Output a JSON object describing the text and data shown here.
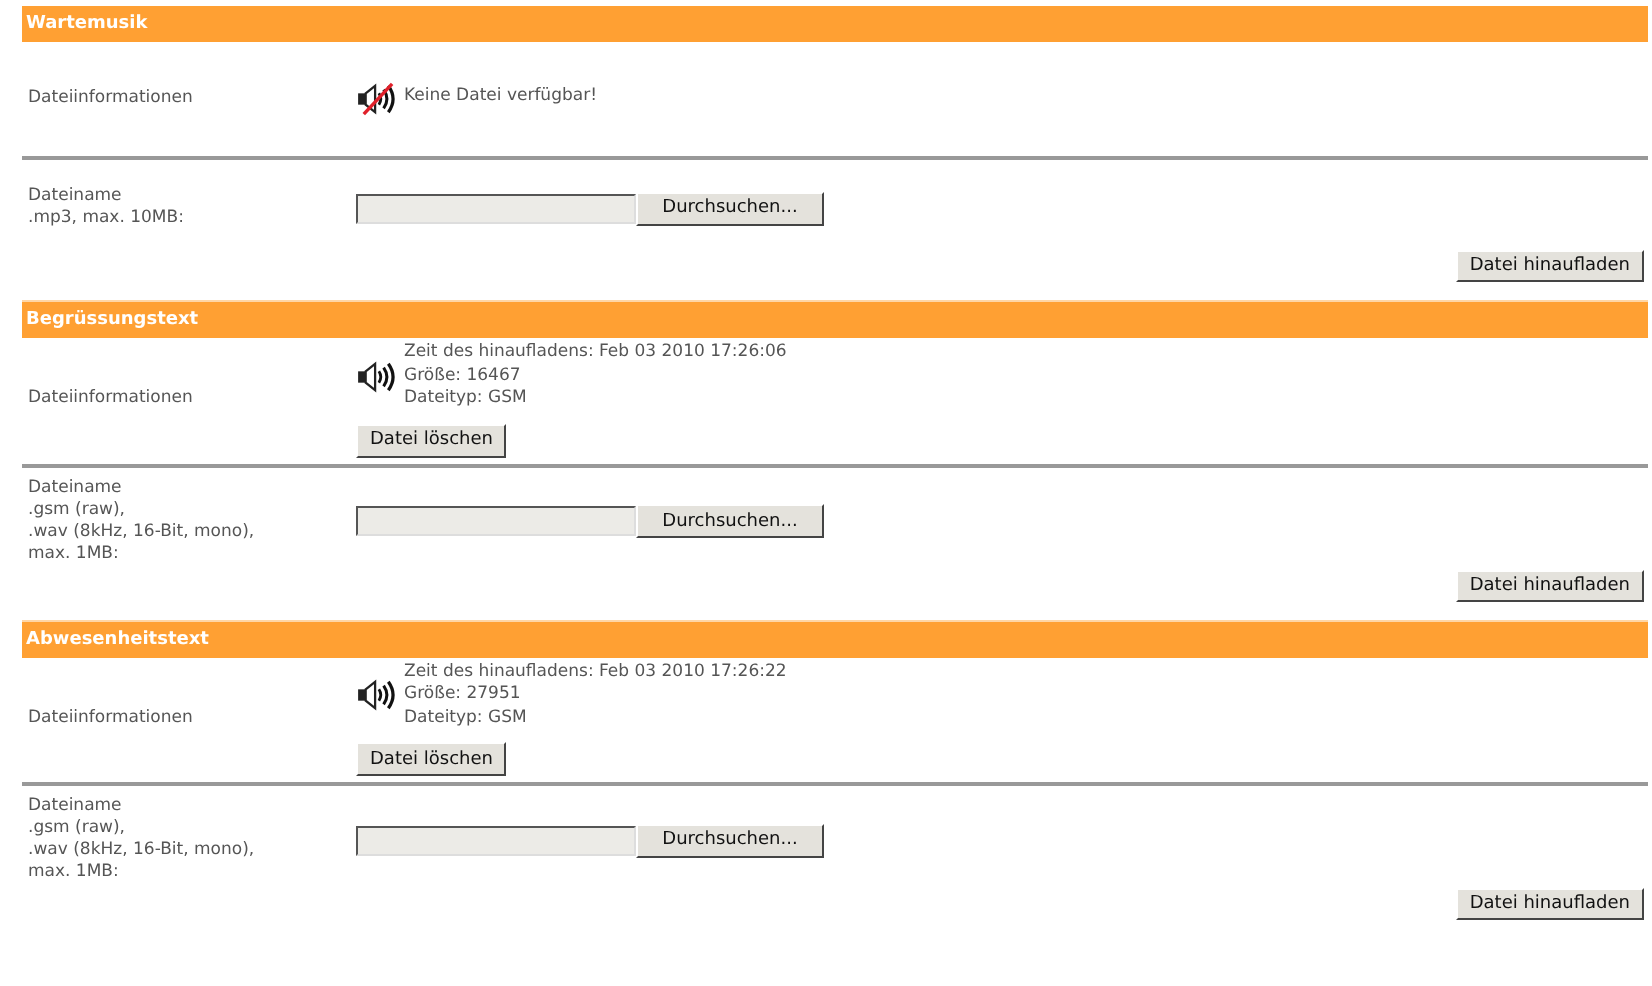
{
  "sections": [
    {
      "title": "Wartemusik",
      "info_label": "Dateiinformationen",
      "file": {
        "kind": "missing",
        "lines": [
          "Keine Datei verfügbar!"
        ]
      },
      "upload_label": [
        "Dateiname",
        ".mp3, max. 10MB:"
      ],
      "browse_button": "Durchsuchen...",
      "upload_button": "Datei hinaufladen"
    },
    {
      "title": "Begrüssungstext",
      "info_label": "Dateiinformationen",
      "file": {
        "kind": "present",
        "lines": [
          "Zeit des hinaufladens: Feb 03 2010 17:26:06",
          "Größe: 16467",
          "Dateityp: GSM"
        ],
        "delete_button": "Datei löschen"
      },
      "upload_label": [
        "Dateiname",
        ".gsm (raw),",
        ".wav (8kHz, 16-Bit, mono),",
        "max. 1MB:"
      ],
      "browse_button": "Durchsuchen...",
      "upload_button": "Datei hinaufladen"
    },
    {
      "title": "Abwesenheitstext",
      "info_label": "Dateiinformationen",
      "file": {
        "kind": "present",
        "lines": [
          "Zeit des hinaufladens: Feb 03 2010 17:26:22",
          "Größe: 27951",
          "Dateityp: GSM"
        ],
        "delete_button": "Datei löschen"
      },
      "upload_label": [
        "Dateiname",
        ".gsm (raw),",
        ".wav (8kHz, 16-Bit, mono),",
        "max. 1MB:"
      ],
      "browse_button": "Durchsuchen...",
      "upload_button": "Datei hinaufladen"
    }
  ]
}
